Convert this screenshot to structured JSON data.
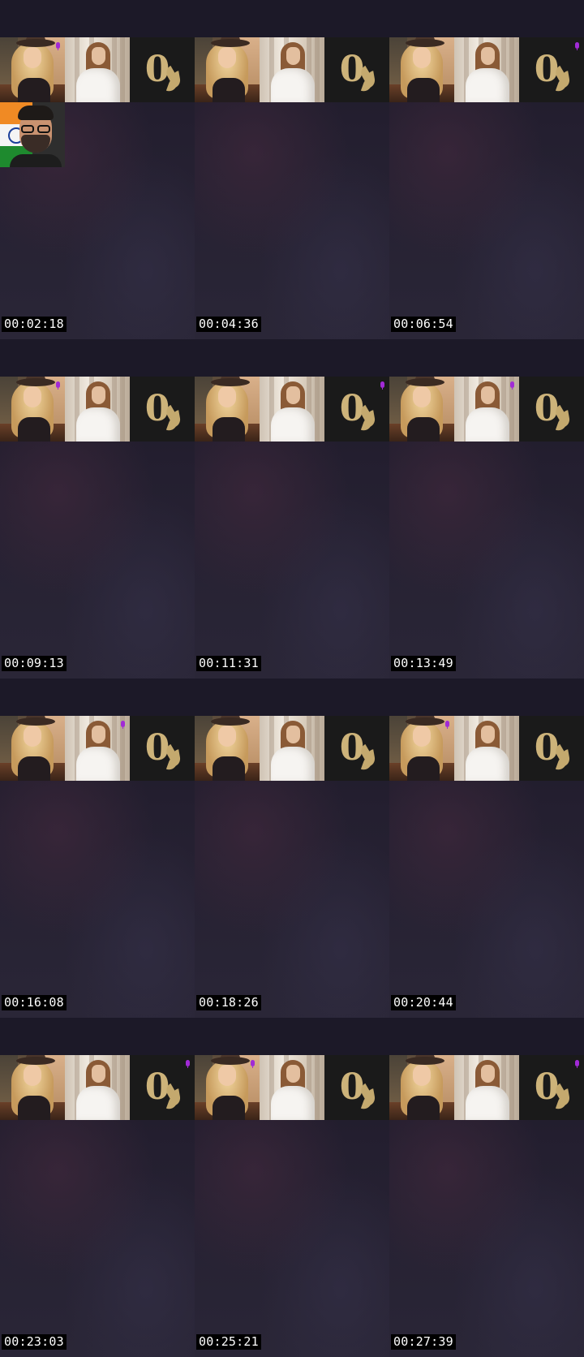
{
  "contact_sheet": {
    "columns": 3,
    "rows": 4,
    "tiles": [
      {
        "timestamp": "00:02:18",
        "mic_on": "hat",
        "guest": true
      },
      {
        "timestamp": "00:04:36",
        "mic_on": "none",
        "guest": false
      },
      {
        "timestamp": "00:06:54",
        "mic_on": "logo",
        "guest": false
      },
      {
        "timestamp": "00:09:13",
        "mic_on": "hat",
        "guest": false
      },
      {
        "timestamp": "00:11:31",
        "mic_on": "logo",
        "guest": false
      },
      {
        "timestamp": "00:13:49",
        "mic_on": "white",
        "guest": false
      },
      {
        "timestamp": "00:16:08",
        "mic_on": "white",
        "guest": false
      },
      {
        "timestamp": "00:18:26",
        "mic_on": "none",
        "guest": false
      },
      {
        "timestamp": "00:20:44",
        "mic_on": "hat",
        "guest": false
      },
      {
        "timestamp": "00:23:03",
        "mic_on": "logo",
        "guest": false
      },
      {
        "timestamp": "00:25:21",
        "mic_on": "hat",
        "guest": false
      },
      {
        "timestamp": "00:27:39",
        "mic_on": "logo",
        "guest": false
      }
    ]
  },
  "icons": {
    "mic": "microphone-icon",
    "logo": "0-leaf-logo",
    "flag": "india-flag"
  },
  "colors": {
    "mic_accent": "#a12ad6",
    "logo_gold": "#cdb37a",
    "background": "#1b1726"
  }
}
